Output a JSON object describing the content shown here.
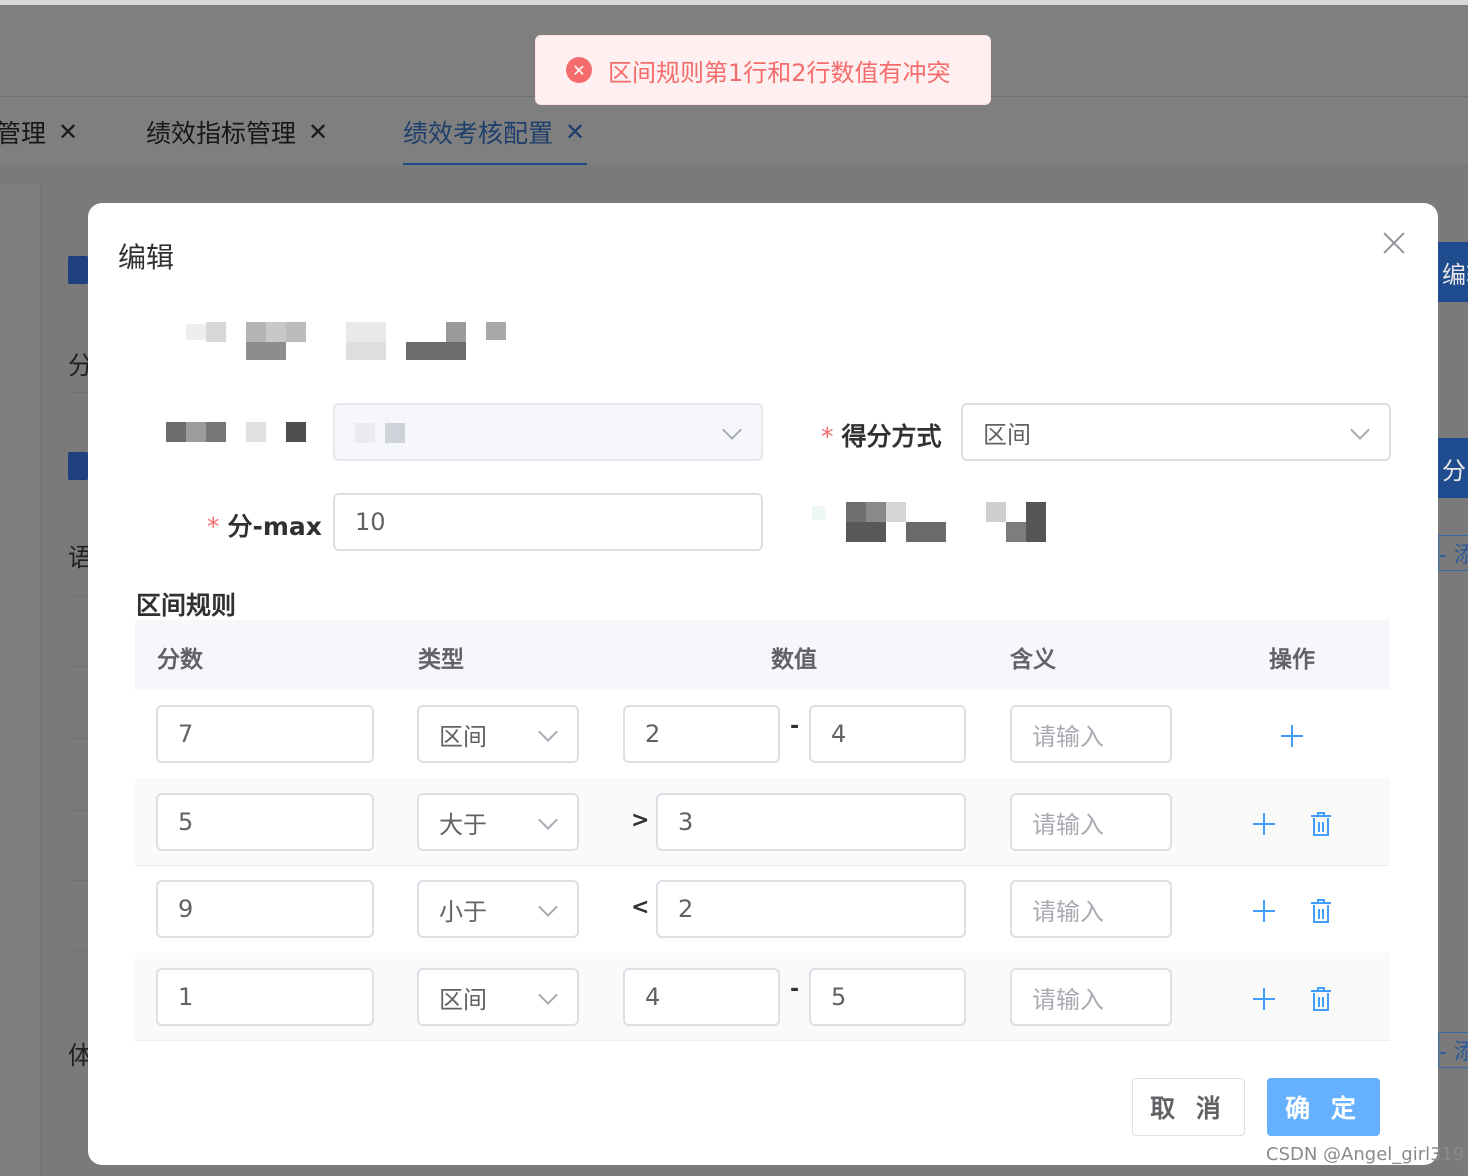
{
  "toast": {
    "icon": "error-circle-icon",
    "message": "区间规则第1行和2行数值有冲突",
    "color": "#f56c6c"
  },
  "tabs": [
    {
      "label": "管理",
      "close": "✕",
      "active": false
    },
    {
      "label": "绩效指标管理",
      "close": "✕",
      "active": false
    },
    {
      "label": "绩效考核配置",
      "close": "✕",
      "active": true
    }
  ],
  "background": {
    "left_texts": [
      "分",
      "语",
      "体"
    ],
    "right_buttons": [
      "编辑",
      "分",
      "- 添",
      "- 添"
    ]
  },
  "dialog": {
    "title": "编辑",
    "close_icon": "close-icon",
    "form": {
      "score_method": {
        "label": "得分方式",
        "value": "区间"
      },
      "score_max": {
        "label": "分-max",
        "value": "10"
      }
    },
    "rules": {
      "title": "区间规则",
      "columns": [
        "分数",
        "类型",
        "数值",
        "含义",
        "操作"
      ],
      "meaning_placeholder": "请输入",
      "rows": [
        {
          "score": "7",
          "type": "区间",
          "op": "-",
          "v1": "2",
          "v2": "4",
          "deletable": false
        },
        {
          "score": "5",
          "type": "大于",
          "op": ">",
          "v1": "3",
          "v2": null,
          "deletable": true
        },
        {
          "score": "9",
          "type": "小于",
          "op": "<",
          "v1": "2",
          "v2": null,
          "deletable": true
        },
        {
          "score": "1",
          "type": "区间",
          "op": "-",
          "v1": "4",
          "v2": "5",
          "deletable": true
        }
      ]
    },
    "buttons": {
      "cancel": "取 消",
      "confirm": "确 定"
    }
  },
  "watermark": "CSDN @Angel_girl319",
  "colors": {
    "primary": "#409eff",
    "danger": "#f56c6c",
    "confirm_bg": "#66b1ff"
  }
}
